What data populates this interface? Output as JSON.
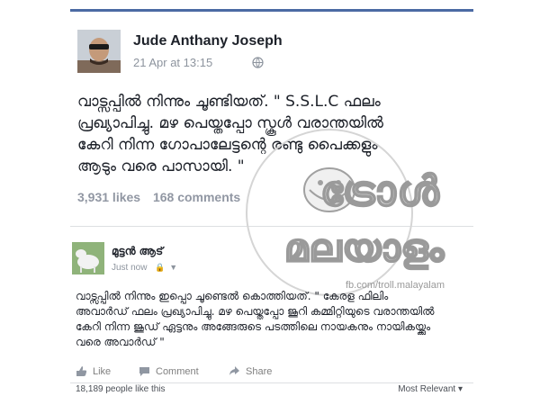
{
  "post": {
    "author": "Jude Anthany Joseph",
    "timestamp": "21 Apr at 13:15",
    "visibility_icon": "globe-icon",
    "text": "വാട്സപ്പിൽ നിന്നും ചൂണ്ടിയത്. \" S.S.L.C ഫലം പ്രഖ്യാപിച്ചു. മഴ പെയ്തപ്പോ സ്കൂൾ വരാന്തയിൽ കേറി നിന്ന ഗോപാലേട്ടന്റെ രണ്ടു പൈക്കളും ആടും വരെ പാസായി. \"",
    "likes": "3,931 likes",
    "comments": "168 comments"
  },
  "watermark": {
    "line1": "ട്രോൾ",
    "line2": "മലയാളം",
    "url": "fb.com/troll.malayalam"
  },
  "reply": {
    "author": "മുട്ടൻ ആട്",
    "timestamp": "Just now",
    "text": "വാട്സപ്പിൽ നിന്നും ഇപ്പൊ ചൂണ്ടെൽ കൊത്തിയത്. \" കേരള ഫിലിം അവാർഡ് ഫലം പ്രഖ്യാപിച്ചു. മഴ പെയ്തപ്പോ ജൂറി കമ്മിറ്റിയുടെ വരാന്തയിൽ കേറി നിന്ന ജൂഡ് ഏട്ടനും അങ്ങേരുടെ പടത്തിലെ നായകനും നായികയ്ക്കും വരെ അവാർഡ് \""
  },
  "actions": {
    "like": "Like",
    "comment": "Comment",
    "share": "Share"
  },
  "footer": {
    "likes": "18,189 people like this",
    "sort": "Most Relevant"
  },
  "colors": {
    "accent": "#4b6aa3",
    "text": "#1d2129",
    "muted": "#8d949e"
  }
}
